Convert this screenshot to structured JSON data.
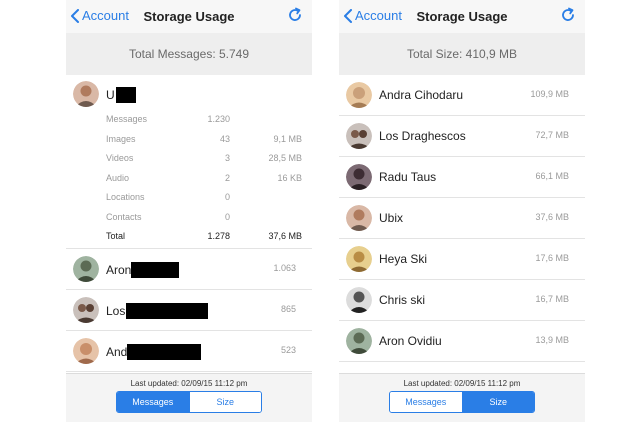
{
  "colors": {
    "accent": "#2a7ee6"
  },
  "left": {
    "back_label": "Account",
    "title": "Storage Usage",
    "summary": "Total Messages: 5.749",
    "expanded": {
      "name": "U",
      "avatar_icon": "person-avatar-icon",
      "stats": [
        {
          "label": "Messages",
          "count": "1.230",
          "size": ""
        },
        {
          "label": "Images",
          "count": "43",
          "size": "9,1 MB"
        },
        {
          "label": "Videos",
          "count": "3",
          "size": "28,5 MB"
        },
        {
          "label": "Audio",
          "count": "2",
          "size": "16 KB"
        },
        {
          "label": "Locations",
          "count": "0",
          "size": ""
        },
        {
          "label": "Contacts",
          "count": "0",
          "size": ""
        },
        {
          "label": "Total",
          "count": "1.278",
          "size": "37,6 MB"
        }
      ]
    },
    "rows": [
      {
        "name": "Aron",
        "value": "1.063"
      },
      {
        "name": "Los",
        "value": "865"
      },
      {
        "name": "And",
        "value": "523"
      }
    ],
    "updated": "Last updated: 02/09/15 11:12 pm",
    "segments": [
      "Messages",
      "Size"
    ],
    "selected_segment": "Messages"
  },
  "right": {
    "back_label": "Account",
    "title": "Storage Usage",
    "summary": "Total Size: 410,9 MB",
    "rows": [
      {
        "name": "Andra Cihodaru",
        "value": "109,9 MB"
      },
      {
        "name": "Los Draghescos",
        "value": "72,7 MB"
      },
      {
        "name": "Radu Taus",
        "value": "66,1 MB"
      },
      {
        "name": "Ubix",
        "value": "37,6 MB"
      },
      {
        "name": "Heya Ski",
        "value": "17,6 MB"
      },
      {
        "name": "Chris ski",
        "value": "16,7 MB"
      },
      {
        "name": "Aron Ovidiu",
        "value": "13,9 MB"
      }
    ],
    "updated": "Last updated: 02/09/15 11:12 pm",
    "segments": [
      "Messages",
      "Size"
    ],
    "selected_segment": "Size"
  }
}
